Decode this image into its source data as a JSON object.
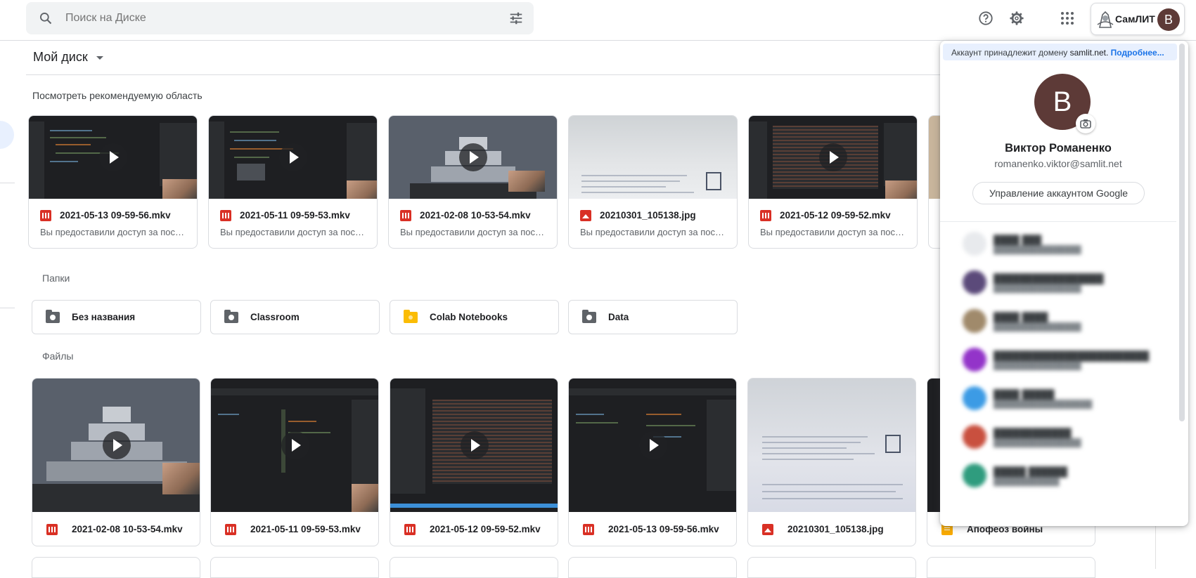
{
  "search": {
    "placeholder": "Поиск на Диске"
  },
  "header": {
    "title": "Мой диск"
  },
  "account_button": {
    "brand": "СамЛИТ",
    "avatar_letter": "В",
    "avatar_color": "#5d3a37"
  },
  "sections": {
    "suggested": "Посмотреть рекомендуемую область",
    "folders": "Папки",
    "files": "Файлы"
  },
  "suggested": [
    {
      "name": "2021-05-13 09-59-56.mkv",
      "type": "video",
      "subtitle": "Вы предоставили доступ за после…"
    },
    {
      "name": "2021-05-11 09-59-53.mkv",
      "type": "video",
      "subtitle": "Вы предоставили доступ за после…"
    },
    {
      "name": "2021-02-08 10-53-54.mkv",
      "type": "video",
      "subtitle": "Вы предоставили доступ за после…"
    },
    {
      "name": "20210301_105138.jpg",
      "type": "image",
      "subtitle": "Вы предоставили доступ за после…"
    },
    {
      "name": "2021-05-12 09-59-52.mkv",
      "type": "video",
      "subtitle": "Вы предоставили доступ за после…"
    }
  ],
  "folders": [
    {
      "name": "Без названия",
      "icon": "shared-folder-icon"
    },
    {
      "name": "Classroom",
      "icon": "shared-folder-icon"
    },
    {
      "name": "Colab Notebooks",
      "icon": "folder-icon"
    },
    {
      "name": "Data",
      "icon": "shared-folder-icon"
    }
  ],
  "files": [
    {
      "name": "2021-02-08 10-53-54.mkv",
      "type": "video"
    },
    {
      "name": "2021-05-11 09-59-53.mkv",
      "type": "video"
    },
    {
      "name": "2021-05-12 09-59-52.mkv",
      "type": "video"
    },
    {
      "name": "2021-05-13 09-59-56.mkv",
      "type": "video"
    },
    {
      "name": "20210301_105138.jpg",
      "type": "image"
    },
    {
      "name": "Апофеоз войны",
      "type": "document"
    }
  ],
  "popup": {
    "domain_prefix": "Аккаунт принадлежит домену ",
    "domain": "samlit.net.",
    "more_link": "Подробнее...",
    "avatar_letter": "В",
    "name": "Виктор Романенко",
    "email": "romanenko.viktor@samlit.net",
    "manage_button": "Управление аккаунтом Google",
    "accounts": [
      {
        "color": "#f1f3f4"
      },
      {
        "color": "#5b4a7a"
      },
      {
        "color": "#a08a6b"
      },
      {
        "color": "#9334c9"
      },
      {
        "color": "#3c9be5"
      },
      {
        "color": "#c9503f"
      },
      {
        "color": "#2f9c7e"
      }
    ]
  },
  "colors": {
    "accent": "#1a73e8",
    "video_icon": "#d93025",
    "folder_yellow": "#fbbc04"
  }
}
